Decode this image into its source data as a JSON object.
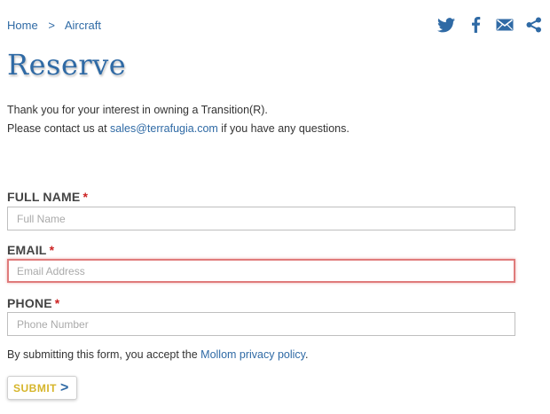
{
  "breadcrumb": {
    "home": "Home",
    "separator": ">",
    "current": "Aircraft"
  },
  "share": {
    "icons": [
      "twitter-icon",
      "facebook-icon",
      "email-icon",
      "share-icon"
    ],
    "color": "#2f6aa5"
  },
  "page": {
    "title": "Reserve"
  },
  "intro": {
    "line1": "Thank you for your interest in owning a Transition(R).",
    "line2_prefix": "Please contact us at ",
    "email_link": "sales@terrafugia.com",
    "line2_suffix": " if you have any questions."
  },
  "form": {
    "required_mark": "*",
    "full_name": {
      "label": "FULL NAME",
      "placeholder": "Full Name",
      "value": ""
    },
    "email": {
      "label": "EMAIL",
      "placeholder": "Email Address",
      "value": "",
      "state": "error"
    },
    "phone": {
      "label": "PHONE",
      "placeholder": "Phone Number",
      "value": ""
    },
    "notice_prefix": "By submitting this form, you accept the ",
    "notice_link": "Mollom privacy policy",
    "notice_suffix": ".",
    "submit_label": "SUBMIT",
    "submit_chevron": ">"
  },
  "colors": {
    "link": "#2f6aa5",
    "required": "#cc2222",
    "error_border": "#e07b7b",
    "submit_text": "#d6b52a"
  }
}
